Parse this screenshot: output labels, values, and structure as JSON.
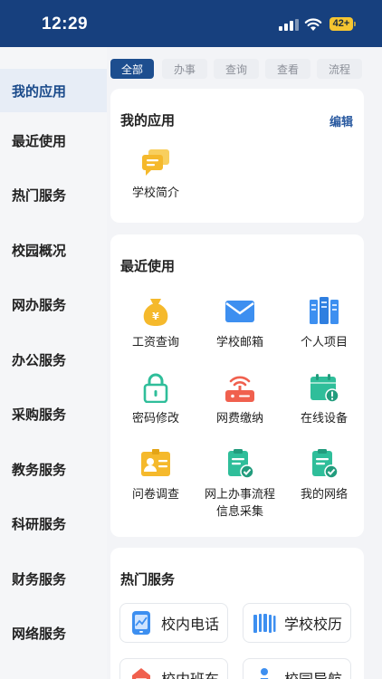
{
  "status_bar": {
    "time": "12:29",
    "battery": "42+"
  },
  "sidebar": {
    "items": [
      {
        "label": "我的应用"
      },
      {
        "label": "最近使用"
      },
      {
        "label": "热门服务"
      },
      {
        "label": "校园概况"
      },
      {
        "label": "网办服务"
      },
      {
        "label": "办公服务"
      },
      {
        "label": "采购服务"
      },
      {
        "label": "教务服务"
      },
      {
        "label": "科研服务"
      },
      {
        "label": "财务服务"
      },
      {
        "label": "网络服务"
      }
    ]
  },
  "tabs": [
    {
      "label": "全部"
    },
    {
      "label": "办事"
    },
    {
      "label": "查询"
    },
    {
      "label": "查看"
    },
    {
      "label": "流程"
    }
  ],
  "my_apps": {
    "title": "我的应用",
    "edit_label": "编辑",
    "items": [
      {
        "label": "学校简介",
        "icon": "chat-bubbles-icon"
      }
    ]
  },
  "recent": {
    "title": "最近使用",
    "items": [
      {
        "label": "工资查询",
        "icon": "money-bag-icon"
      },
      {
        "label": "学校邮箱",
        "icon": "mail-icon"
      },
      {
        "label": "个人项目",
        "icon": "server-rack-icon"
      },
      {
        "label": "密码修改",
        "icon": "padlock-icon"
      },
      {
        "label": "网费缴纳",
        "icon": "router-icon"
      },
      {
        "label": "在线设备",
        "icon": "calendar-alert-icon"
      },
      {
        "label": "问卷调查",
        "icon": "id-card-icon"
      },
      {
        "label": "网上办事流程信息采集",
        "icon": "clipboard-check-icon"
      },
      {
        "label": "我的网络",
        "icon": "clipboard-check-icon"
      }
    ]
  },
  "hot": {
    "title": "热门服务",
    "items": [
      {
        "label": "校内电话",
        "icon": "phone-icon"
      },
      {
        "label": "学校校历",
        "icon": "barcode-calendar-icon"
      },
      {
        "label": "校内班车",
        "icon": "bus-icon"
      },
      {
        "label": "校园导航",
        "icon": "navigation-icon"
      }
    ]
  },
  "colors": {
    "status_bar": "#17407e",
    "accent": "#1d4e8f",
    "icon_yellow": "#f5b92c",
    "icon_blue": "#3d8ff0",
    "icon_green": "#2fbe9a",
    "icon_red": "#f0604e"
  }
}
